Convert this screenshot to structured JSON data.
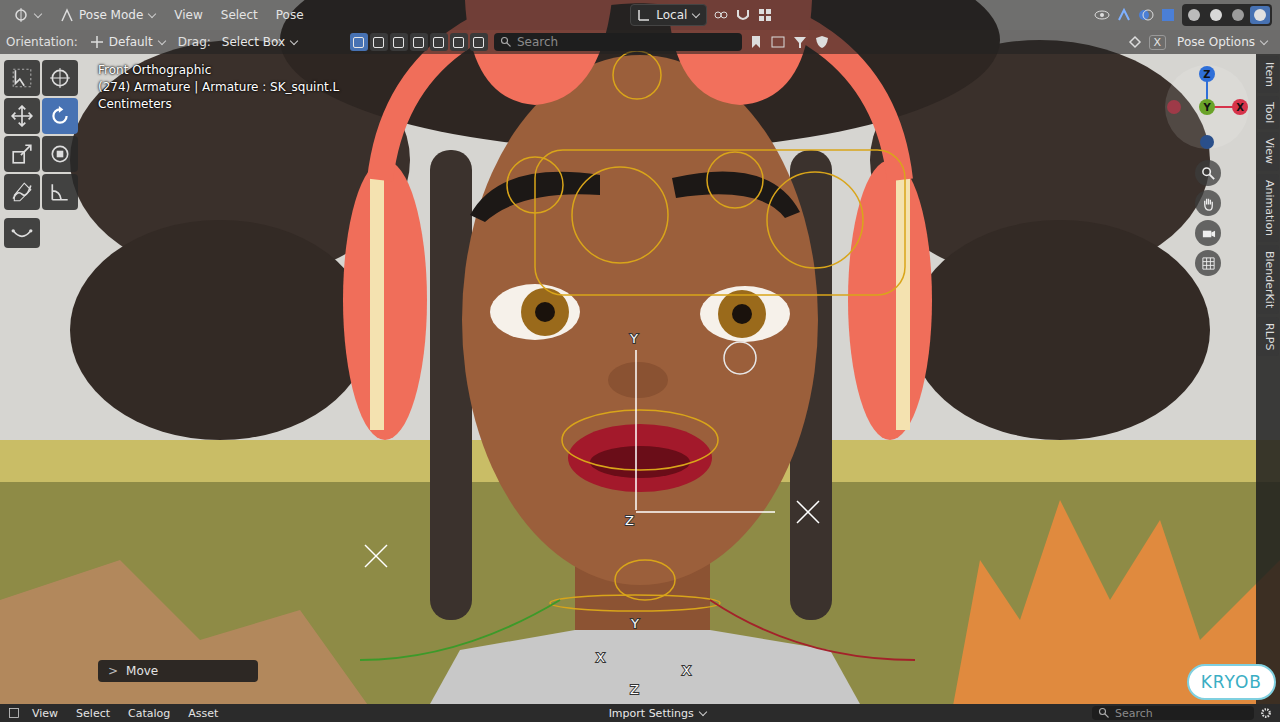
{
  "header": {
    "mode": "Pose Mode",
    "menus": [
      "View",
      "Select",
      "Pose"
    ],
    "orientation": "Local",
    "shading": [
      {
        "selected": false
      },
      {
        "selected": false
      },
      {
        "selected": false
      },
      {
        "selected": true
      }
    ]
  },
  "tool_settings": {
    "orientation_label": "Orientation:",
    "orientation_value": "Default",
    "drag_label": "Drag:",
    "drag_value": "Select Box",
    "select_modes": [
      {
        "selected": true
      },
      {
        "selected": false
      },
      {
        "selected": false
      },
      {
        "selected": false
      },
      {
        "selected": false
      },
      {
        "selected": false
      },
      {
        "selected": false
      }
    ],
    "search_placeholder": "Search",
    "close": "X",
    "options": "Pose Options"
  },
  "viewport": {
    "view": "Front Orthographic",
    "object": "(274) Armature | Armature : SK_squint.L",
    "units": "Centimeters"
  },
  "tools": [
    {
      "kind": "select",
      "selected": false
    },
    {
      "kind": "cursor",
      "selected": false
    },
    {
      "kind": "move",
      "selected": false
    },
    {
      "kind": "rotate",
      "selected": true
    },
    {
      "kind": "scale",
      "selected": false
    },
    {
      "kind": "transform",
      "selected": false
    },
    {
      "kind": "annotate",
      "selected": false
    },
    {
      "kind": "measure",
      "selected": false
    },
    {
      "kind": "curve",
      "selected": false
    }
  ],
  "gizmo": {
    "axes": [
      {
        "label": "Z",
        "color": "#2f6fd8"
      },
      {
        "label": "Y",
        "color": "#6aa329"
      },
      {
        "label": "X",
        "color": "#d6334a"
      }
    ]
  },
  "scene_axes": [
    {
      "label": "Y"
    },
    {
      "label": "Z"
    },
    {
      "label": "Y"
    },
    {
      "label": "X"
    },
    {
      "label": "X"
    },
    {
      "label": "Z"
    }
  ],
  "side_tabs": [
    {
      "label": "Item",
      "selected": false
    },
    {
      "label": "Tool",
      "selected": false
    },
    {
      "label": "View",
      "selected": false
    },
    {
      "label": "Animation",
      "selected": false
    },
    {
      "label": "BlenderKit",
      "selected": false
    },
    {
      "label": "RLPS",
      "selected": false
    }
  ],
  "last_operator": {
    "toggle": ">",
    "name": "Move"
  },
  "asset_bar": {
    "menus": [
      "View",
      "Select",
      "Catalog",
      "Asset"
    ],
    "import": "Import Settings",
    "search_placeholder": "Search"
  },
  "watermark": "KRYOB"
}
